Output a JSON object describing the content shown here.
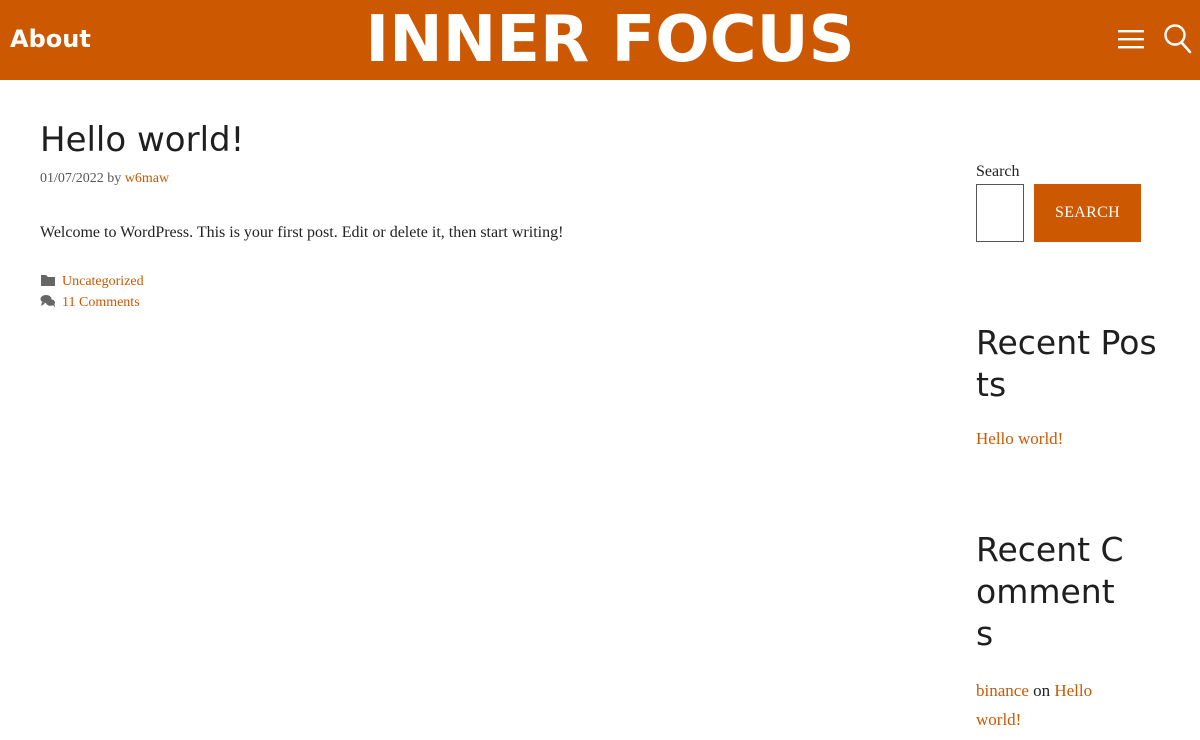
{
  "header": {
    "nav_about": "About",
    "site_title": "INNER FOCUS",
    "menu_icon": "hamburger-menu-icon",
    "search_icon": "magnifier-search-icon",
    "background_color": "#cc5801"
  },
  "post": {
    "title": "Hello world!",
    "date": "01/07/2022",
    "by": "by",
    "author": "w6maw",
    "body": "Welcome to WordPress. This is your first post. Edit or delete it, then start writing!",
    "category_icon": "folder-icon",
    "category": "Uncategorized",
    "comments_icon": "comments-icon",
    "comments_link": "11 Comments"
  },
  "sidebar": {
    "search": {
      "label": "Search",
      "input_value": "",
      "button_label": "SEARCH"
    },
    "recent_posts": {
      "title": "Recent Posts",
      "items": [
        "Hello world!"
      ]
    },
    "recent_comments": {
      "title": "Recent Comments",
      "items": [
        {
          "author": "binance",
          "on": "on",
          "post": "Hello world!"
        }
      ]
    }
  },
  "colors": {
    "accent": "#cc5801",
    "text": "#222222"
  }
}
